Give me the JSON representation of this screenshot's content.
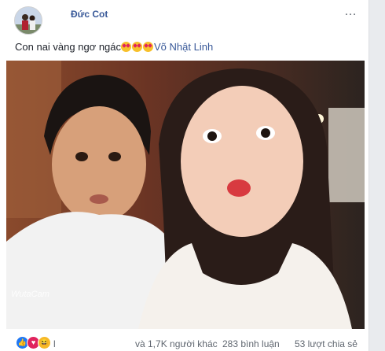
{
  "post": {
    "author": "Đức Cot",
    "more_icon": "…",
    "caption_text": "Con nai vàng ngơ ngác",
    "emojis": [
      "star-struck-emoji",
      "star-struck-emoji",
      "star-struck-emoji"
    ],
    "caption_tag": "Võ Nhật Linh",
    "watermark": "WutaCam"
  },
  "footer": {
    "reactions": [
      "like",
      "love",
      "haha"
    ],
    "reactors_prefix": "l",
    "reactors_suffix": "và 1,7K người khác",
    "comments": "283 bình luận",
    "shares": "53 lượt chia sẻ"
  },
  "colors": {
    "link": "#385898",
    "text": "#1d2129",
    "muted": "#606770",
    "like": "#2078f4",
    "love": "#e0245e",
    "haha": "#f7b928"
  }
}
